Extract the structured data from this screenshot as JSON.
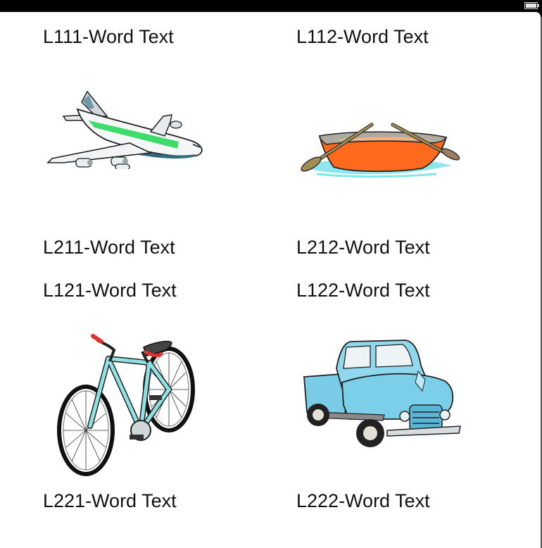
{
  "status_bar": {
    "battery": {
      "icon": "battery-icon",
      "level": 1.0
    }
  },
  "cards": [
    {
      "top_label": "L111-Word Text",
      "image": "airplane",
      "bottom_label": "L211-Word Text"
    },
    {
      "top_label": "L112-Word Text",
      "image": "rowboat",
      "bottom_label": "L212-Word Text"
    },
    {
      "top_label": "L121-Word Text",
      "image": "bicycle",
      "bottom_label": "L221-Word Text"
    },
    {
      "top_label": "L122-Word Text",
      "image": "pickup-truck",
      "bottom_label": "L222-Word Text"
    }
  ]
}
